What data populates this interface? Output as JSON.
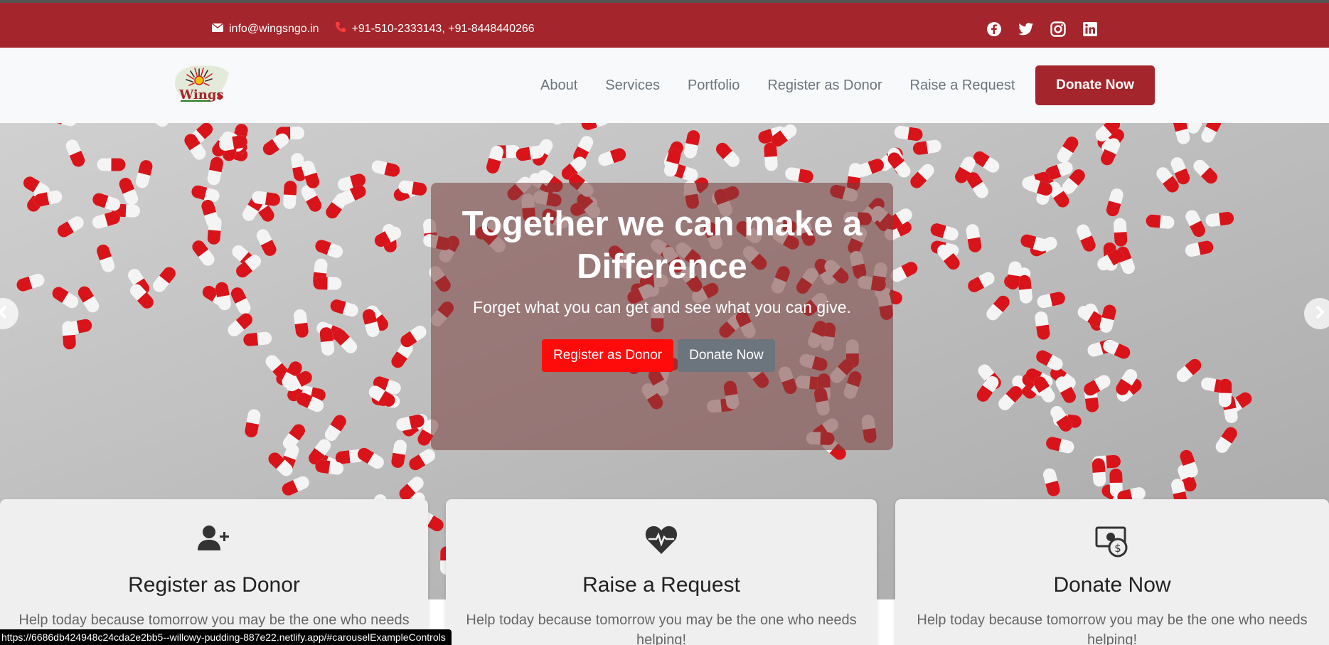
{
  "topbar": {
    "email": "info@wingsngo.in",
    "phone": "+91-510-2333143, +91-8448440266",
    "icons": [
      "mail-icon",
      "phone-icon",
      "facebook-icon",
      "twitter-icon",
      "instagram-icon",
      "linkedin-icon"
    ]
  },
  "navbar": {
    "logo_text": "Wings",
    "links": [
      "About",
      "Services",
      "Portfolio",
      "Register as Donor",
      "Raise a Request"
    ],
    "donate_label": "Donate Now"
  },
  "hero": {
    "title": "Together we can make a Difference",
    "subtitle": "Forget what you can get and see what you can give.",
    "primary_button": "Register as Donor",
    "secondary_button": "Donate Now",
    "prev_icon": "chevron-left-icon",
    "next_icon": "chevron-right-icon"
  },
  "cards": [
    {
      "icon": "add-user-icon",
      "title": "Register as Donor",
      "text": "Help today because tomorrow you may be the one who needs helping!"
    },
    {
      "icon": "heartbeat-icon",
      "title": "Raise a Request",
      "text": "Help today because tomorrow you may be the one who needs helping!"
    },
    {
      "icon": "donate-money-icon",
      "title": "Donate Now",
      "text": "Help today because tomorrow you may be the one who needs helping!"
    }
  ],
  "status_url": "https://6686db424948c24cda2e2bb5--willowy-pudding-887e22.netlify.app/#carouselExampleControls",
  "colors": {
    "brand": "#a4262c",
    "accent_red": "#fe0c0c",
    "secondary": "#6c757d"
  }
}
